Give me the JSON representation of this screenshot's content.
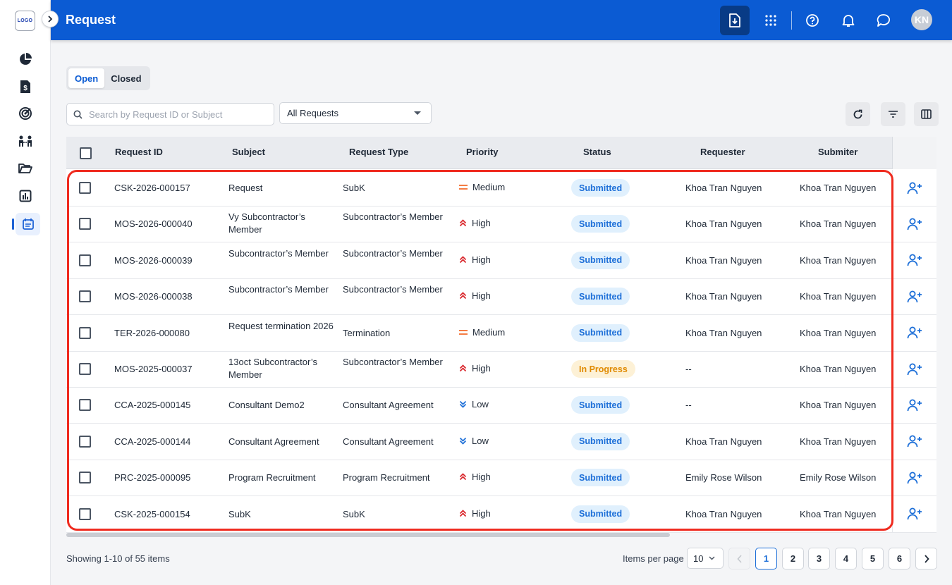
{
  "sidebar": {
    "logo_text": "LOGO",
    "nav_items": [
      "dashboard-pie",
      "invoice",
      "target",
      "team",
      "folder",
      "report",
      "calendar-request"
    ]
  },
  "header": {
    "title": "Request",
    "avatar_initials": "KN",
    "color": "#0b5bd3"
  },
  "tabs": {
    "open": "Open",
    "closed": "Closed"
  },
  "filters": {
    "search_placeholder": "Search by Request ID or Subject",
    "search_value": "",
    "request_filter": "All Requests"
  },
  "table": {
    "columns": {
      "request_id": "Request ID",
      "subject": "Subject",
      "request_type": "Request Type",
      "priority": "Priority",
      "status": "Status",
      "requester": "Requester",
      "submitter": "Submiter"
    },
    "rows": [
      {
        "id": "CSK-2026-000157",
        "subject": "Request",
        "type": "SubK",
        "priority": "Medium",
        "status": "Submitted",
        "requester": "Khoa Tran Nguyen",
        "submitter": "Khoa Tran Nguyen"
      },
      {
        "id": "MOS-2026-000040",
        "subject": "Vy Subcontractor’s Member",
        "type": "Subcontractor’s Member",
        "priority": "High",
        "status": "Submitted",
        "requester": "Khoa Tran Nguyen",
        "submitter": "Khoa Tran Nguyen"
      },
      {
        "id": "MOS-2026-000039",
        "subject": "Subcontractor’s Member",
        "type": "Subcontractor’s Member",
        "priority": "High",
        "status": "Submitted",
        "requester": "Khoa Tran Nguyen",
        "submitter": "Khoa Tran Nguyen"
      },
      {
        "id": "MOS-2026-000038",
        "subject": "Subcontractor’s Member",
        "type": "Subcontractor’s Member",
        "priority": "High",
        "status": "Submitted",
        "requester": "Khoa Tran Nguyen",
        "submitter": "Khoa Tran Nguyen"
      },
      {
        "id": "TER-2026-000080",
        "subject": "Request termination 2026",
        "type": "Termination",
        "priority": "Medium",
        "status": "Submitted",
        "requester": "Khoa Tran Nguyen",
        "submitter": "Khoa Tran Nguyen"
      },
      {
        "id": "MOS-2025-000037",
        "subject": "13oct Subcontractor’s Member",
        "type": "Subcontractor’s Member",
        "priority": "High",
        "status": "In Progress",
        "requester": "--",
        "submitter": "Khoa Tran Nguyen"
      },
      {
        "id": "CCA-2025-000145",
        "subject": "Consultant Demo2",
        "type": "Consultant Agreement",
        "priority": "Low",
        "status": "Submitted",
        "requester": "--",
        "submitter": "Khoa Tran Nguyen"
      },
      {
        "id": "CCA-2025-000144",
        "subject": "Consultant Agreement",
        "type": "Consultant Agreement",
        "priority": "Low",
        "status": "Submitted",
        "requester": "Khoa Tran Nguyen",
        "submitter": "Khoa Tran Nguyen"
      },
      {
        "id": "PRC-2025-000095",
        "subject": "Program Recruitment",
        "type": "Program Recruitment",
        "priority": "High",
        "status": "Submitted",
        "requester": "Emily Rose Wilson",
        "submitter": "Emily Rose Wilson"
      },
      {
        "id": "CSK-2025-000154",
        "subject": "SubK",
        "type": "SubK",
        "priority": "High",
        "status": "Submitted",
        "requester": "Khoa Tran Nguyen",
        "submitter": "Khoa Tran Nguyen"
      }
    ]
  },
  "pagination": {
    "showing": "Showing 1-10 of 55 items",
    "items_per_page_label": "Items per page",
    "items_per_page": "10",
    "pages": [
      "1",
      "2",
      "3",
      "4",
      "5",
      "6"
    ],
    "current_page": "1"
  },
  "colors": {
    "priority_high": "#d9262b",
    "priority_medium": "#f26b2a",
    "priority_low": "#1d6fd8",
    "highlight": "#ef2b1f"
  }
}
